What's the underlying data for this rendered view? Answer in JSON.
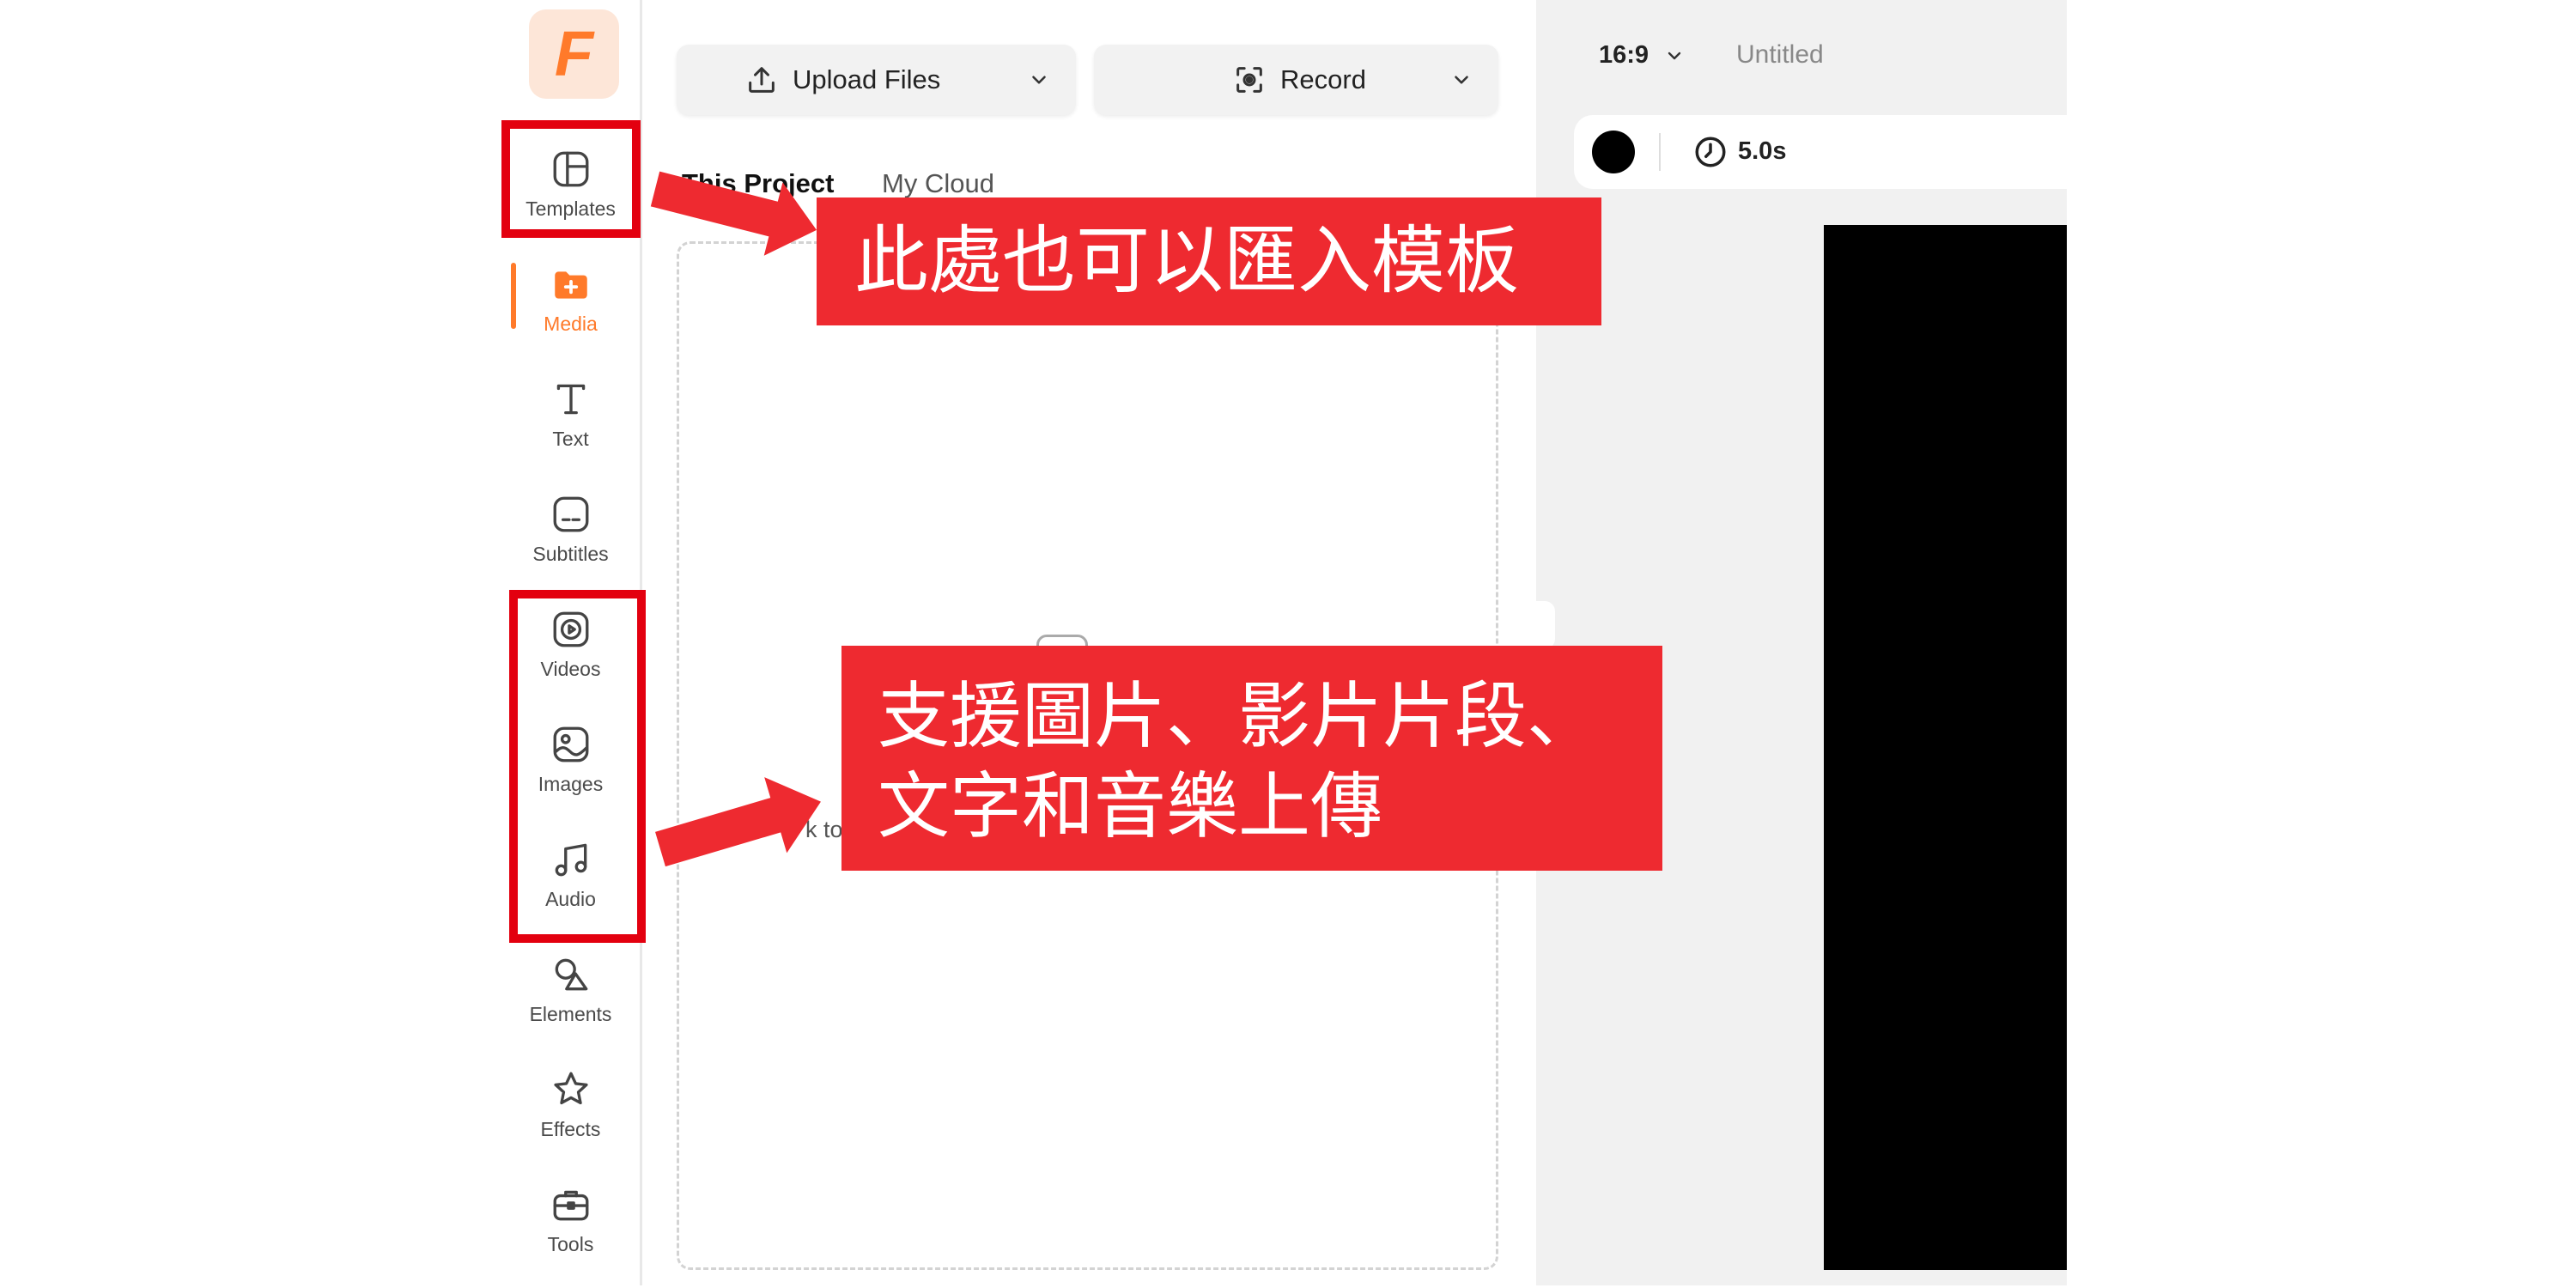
{
  "logo": {
    "letter": "F"
  },
  "sidebar": {
    "items": [
      {
        "label": "Templates",
        "icon": "templates-icon"
      },
      {
        "label": "Media",
        "icon": "media-folder-icon",
        "active": true
      },
      {
        "label": "Text",
        "icon": "text-icon"
      },
      {
        "label": "Subtitles",
        "icon": "subtitles-icon"
      },
      {
        "label": "Videos",
        "icon": "videos-icon"
      },
      {
        "label": "Images",
        "icon": "images-icon"
      },
      {
        "label": "Audio",
        "icon": "audio-icon"
      },
      {
        "label": "Elements",
        "icon": "elements-icon"
      },
      {
        "label": "Effects",
        "icon": "effects-icon"
      },
      {
        "label": "Tools",
        "icon": "tools-icon"
      }
    ]
  },
  "media_panel": {
    "upload": {
      "label": "Upload Files",
      "icon": "upload-icon"
    },
    "record": {
      "label": "Record",
      "icon": "screen-record-icon"
    },
    "tabs": [
      {
        "label": "This Project",
        "active": true
      },
      {
        "label": "My Cloud",
        "active": false
      }
    ],
    "drop_hint": "k to"
  },
  "editor": {
    "aspect_ratio": "16:9",
    "project_title": "Untitled",
    "background_swatch": "#000000",
    "duration": "5.0s",
    "canvas_color": "#000000"
  },
  "annotations": [
    {
      "text": "此處也可以匯入模板"
    },
    {
      "lines": [
        "支援圖片、影片片段、",
        "文字和音樂上傳"
      ]
    }
  ],
  "colors": {
    "accent": "#ff7a2a",
    "annotation_red": "#ee2a30",
    "highlight_outline": "#e3000f"
  }
}
